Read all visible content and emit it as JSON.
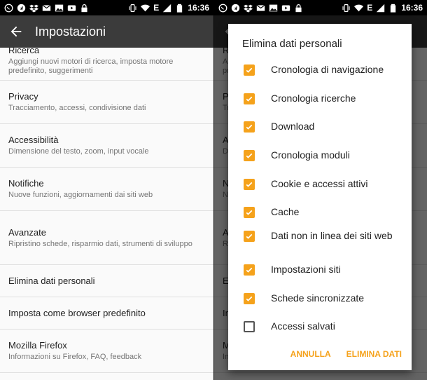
{
  "status_bar": {
    "time": "16:36",
    "network_label": "E",
    "left_icons": [
      "whatsapp-icon",
      "telegram-icon",
      "dropbox-icon",
      "mail-icon",
      "image-icon",
      "youtube-icon",
      "lock-icon"
    ],
    "right_icons": [
      "vibrate-icon",
      "wifi-icon",
      "signal-icon",
      "battery-icon"
    ]
  },
  "appbar": {
    "title": "Impostazioni",
    "back_icon": "arrow-back-icon"
  },
  "settings": [
    {
      "title": "Ricerca",
      "summary": "Aggiungi nuovi motori di ricerca, imposta motore predefinito, suggerimenti"
    },
    {
      "title": "Privacy",
      "summary": "Tracciamento, accessi, condivisione dati"
    },
    {
      "title": "Accessibilità",
      "summary": "Dimensione del testo, zoom, input vocale"
    },
    {
      "title": "Notifiche",
      "summary": "Nuove funzioni, aggiornamenti dai siti web"
    },
    {
      "title": "Avanzate",
      "summary": "Ripristino schede, risparmio dati, strumenti di sviluppo"
    },
    {
      "title": "Elimina dati personali",
      "summary": ""
    },
    {
      "title": "Imposta come browser predefinito",
      "summary": ""
    },
    {
      "title": "Mozilla Firefox",
      "summary": "Informazioni su Firefox, FAQ, feedback"
    }
  ],
  "dialog": {
    "title": "Elimina dati personali",
    "options": [
      {
        "label": "Cronologia di navigazione",
        "checked": true
      },
      {
        "label": "Cronologia ricerche",
        "checked": true
      },
      {
        "label": "Download",
        "checked": true
      },
      {
        "label": "Cronologia moduli",
        "checked": true
      },
      {
        "label": "Cookie e accessi attivi",
        "checked": true
      },
      {
        "label": "Cache",
        "checked": true
      },
      {
        "label": "Dati non in linea dei siti web",
        "checked": true
      },
      {
        "label": "Impostazioni siti",
        "checked": true
      },
      {
        "label": "Schede sincronizzate",
        "checked": true
      },
      {
        "label": "Accessi salvati",
        "checked": false
      }
    ],
    "cancel_label": "ANNULLA",
    "confirm_label": "ELIMINA DATI"
  },
  "colors": {
    "accent": "#f5a21b",
    "toolbar": "#3b3b3b",
    "status_bar": "#000000"
  }
}
